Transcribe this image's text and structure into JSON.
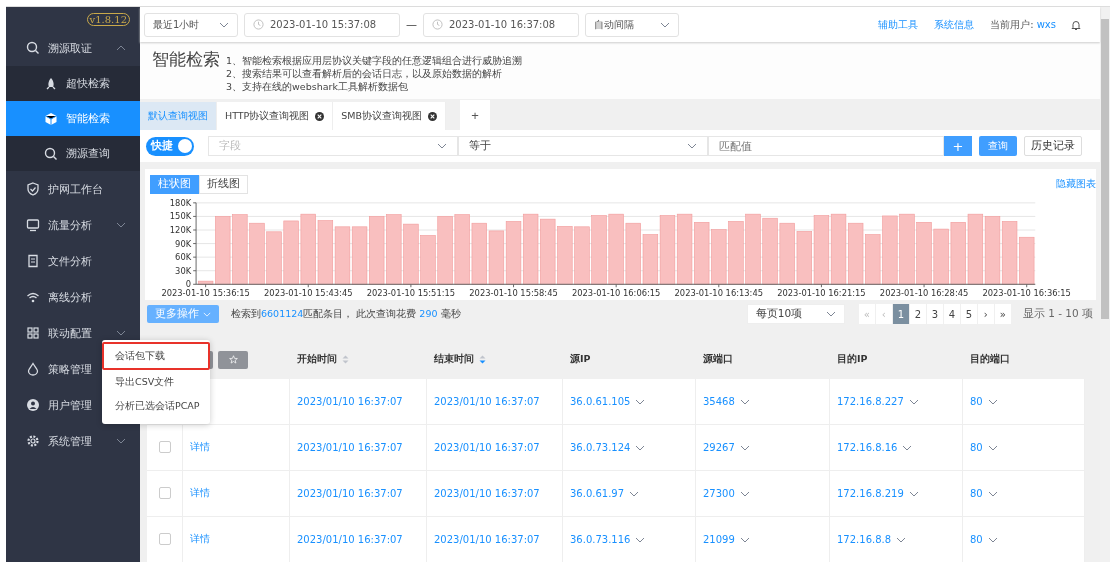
{
  "sidebar": {
    "version": "v1.8.12",
    "items": [
      {
        "label": "溯源取证",
        "selected": false,
        "expanded": true,
        "children": [
          {
            "label": "超快检索",
            "selected": false
          },
          {
            "label": "智能检索",
            "selected": true
          },
          {
            "label": "溯源查询",
            "selected": false
          }
        ]
      },
      {
        "label": "护网工作台",
        "selected": false
      },
      {
        "label": "流量分析",
        "selected": false,
        "expanded": false
      },
      {
        "label": "文件分析",
        "selected": false
      },
      {
        "label": "离线分析",
        "selected": false
      },
      {
        "label": "联动配置",
        "selected": false,
        "expanded": false
      },
      {
        "label": "策略管理",
        "selected": false
      },
      {
        "label": "用户管理",
        "selected": false
      },
      {
        "label": "系统管理",
        "selected": false,
        "expanded": false
      }
    ]
  },
  "topbar": {
    "range_select": "最近1小时",
    "start_time": "2023-01-10 15:37:08",
    "separator": "—",
    "end_time": "2023-01-10 16:37:08",
    "interval_select": "自动间隔",
    "links": [
      "辅助工具",
      "系统信息"
    ],
    "user_label": "当前用户:",
    "user_name": "wxs"
  },
  "header": {
    "title": "智能检索",
    "notes": [
      "1、智能检索根据应用层协议关键字段的任意逻辑组合进行威胁追溯",
      "2、搜索结果可以查看解析后的会话日志，以及原始数据的解析",
      "3、支持在线的webshark工具解析数据包"
    ]
  },
  "tabs": [
    {
      "label": "默认查询视图",
      "selected": true,
      "closable": false
    },
    {
      "label": "HTTP协议查询视图",
      "selected": false,
      "closable": true
    },
    {
      "label": "SMB协议查询视图",
      "selected": false,
      "closable": true
    }
  ],
  "add_tab": "+",
  "query": {
    "quick_toggle": {
      "label": "快捷",
      "on": true
    },
    "field": {
      "placeholder": "字段"
    },
    "operator": {
      "value": "等于"
    },
    "match": {
      "placeholder": "匹配值"
    },
    "add_button": "+",
    "search_button": "查询",
    "history_button": "历史记录"
  },
  "chart_panel": {
    "views": [
      {
        "label": "柱状图",
        "selected": true
      },
      {
        "label": "折线图",
        "selected": false
      }
    ],
    "hide_link": "隐藏图表",
    "chart_data": {
      "type": "bar",
      "ylim": [
        0,
        180000
      ],
      "values": [
        7000,
        150000,
        154000,
        135000,
        116000,
        140000,
        155000,
        141000,
        127000,
        127000,
        150000,
        154000,
        133000,
        108000,
        150000,
        154000,
        135000,
        118000,
        139000,
        155000,
        144000,
        128000,
        127000,
        152000,
        155000,
        135000,
        110000,
        152000,
        155000,
        137000,
        121000,
        139000,
        155000,
        146000,
        135000,
        117000,
        152000,
        155000,
        135000,
        110000,
        151000,
        155000,
        137000,
        122000,
        137000,
        155000,
        150000,
        139000,
        104000
      ],
      "yticks": [
        {
          "value": 0,
          "label": "0"
        },
        {
          "value": 30000,
          "label": "30K"
        },
        {
          "value": 60000,
          "label": "60K"
        },
        {
          "value": 90000,
          "label": "90K"
        },
        {
          "value": 120000,
          "label": "120K"
        },
        {
          "value": 150000,
          "label": "150K"
        },
        {
          "value": 180000,
          "label": "180K"
        }
      ],
      "grid": true,
      "categories": [
        "2023-01-10 15:36:15",
        null,
        null,
        null,
        null,
        null,
        "2023-01-10 15:43:45",
        null,
        null,
        null,
        null,
        null,
        "2023-01-10 15:51:15",
        null,
        null,
        null,
        null,
        null,
        "2023-01-10 15:58:45",
        null,
        null,
        null,
        null,
        null,
        "2023-01-10 16:06:15",
        null,
        null,
        null,
        null,
        null,
        "2023-01-10 16:13:45",
        null,
        null,
        null,
        null,
        null,
        "2023-01-10 16:21:15",
        null,
        null,
        null,
        null,
        null,
        "2023-01-10 16:28:45",
        null,
        null,
        null,
        null,
        null,
        "2023-01-10 16:36:15"
      ]
    }
  },
  "actions": {
    "more_button": "更多操作",
    "summary": {
      "prefix": "检索到",
      "count": "6601124",
      "middle": "匹配条目， 此次查询花费 ",
      "time": "290",
      "suffix": " 毫秒"
    },
    "page_size": "每页10项",
    "pages": [
      {
        "label": "«",
        "selected": false,
        "disabled": true
      },
      {
        "label": "‹",
        "selected": false,
        "disabled": true
      },
      {
        "label": "1",
        "selected": true,
        "disabled": false
      },
      {
        "label": "2",
        "selected": false,
        "disabled": false
      },
      {
        "label": "3",
        "selected": false,
        "disabled": false
      },
      {
        "label": "4",
        "selected": false,
        "disabled": false
      },
      {
        "label": "5",
        "selected": false,
        "disabled": false
      },
      {
        "label": "›",
        "selected": false,
        "disabled": false
      },
      {
        "label": "»",
        "selected": false,
        "disabled": false
      }
    ],
    "range_text": "显示 1 - 10 项"
  },
  "menu": {
    "items": [
      {
        "label": "会话包下载",
        "highlighted": true
      },
      {
        "label": "导出CSV文件",
        "highlighted": false
      },
      {
        "label": "分析已选会话PCAP",
        "highlighted": false
      }
    ]
  },
  "table": {
    "columns": [
      {
        "label": "开始时间",
        "kind": "time",
        "sortable": true,
        "sorted": false
      },
      {
        "label": "结束时间",
        "kind": "time",
        "sortable": true,
        "sorted": true
      },
      {
        "label": "源IP",
        "kind": "dropdown"
      },
      {
        "label": "源端口",
        "kind": "dropdown"
      },
      {
        "label": "目的IP",
        "kind": "dropdown"
      },
      {
        "label": "目的端口",
        "kind": "dropdown"
      }
    ],
    "rows": [
      {
        "cells": [
          "2023/01/10 16:37:07",
          "2023/01/10 16:37:07",
          "36.0.61.105",
          "35468",
          "172.16.8.227",
          "80"
        ]
      },
      {
        "checked": false,
        "detail": "详情",
        "cells": [
          "2023/01/10 16:37:07",
          "2023/01/10 16:37:07",
          "36.0.73.124",
          "29267",
          "172.16.8.16",
          "80"
        ]
      },
      {
        "checked": false,
        "detail": "详情",
        "cells": [
          "2023/01/10 16:37:07",
          "2023/01/10 16:37:07",
          "36.0.61.97",
          "27300",
          "172.16.8.219",
          "80"
        ]
      },
      {
        "checked": false,
        "detail": "详情",
        "cells": [
          "2023/01/10 16:37:07",
          "2023/01/10 16:37:07",
          "36.0.73.116",
          "21099",
          "172.16.8.8",
          "80"
        ]
      }
    ]
  }
}
